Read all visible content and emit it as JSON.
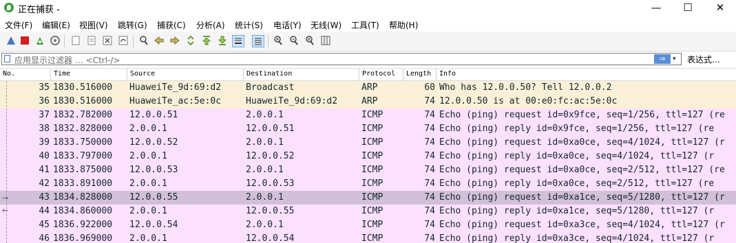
{
  "window": {
    "title": "正在捕获 -",
    "minimize": "—",
    "maximize": "☐",
    "close": "✕"
  },
  "menu": [
    "文件(F)",
    "编辑(E)",
    "视图(V)",
    "跳转(G)",
    "捕获(C)",
    "分析(A)",
    "统计(S)",
    "电话(Y)",
    "无线(W)",
    "工具(T)",
    "帮助(H)"
  ],
  "toolbar": {
    "icons": [
      "shark-fin-start-icon",
      "stop-capture-icon",
      "restart-capture-icon",
      "capture-options-icon",
      "open-file-icon",
      "save-file-icon",
      "close-file-icon",
      "reload-file-icon",
      "find-packet-icon",
      "go-back-icon",
      "go-forward-icon",
      "go-to-packet-icon",
      "go-first-icon",
      "go-last-icon",
      "autoscroll-icon",
      "colorize-icon",
      "zoom-in-icon",
      "zoom-out-icon",
      "zoom-normal-icon",
      "resize-columns-icon"
    ]
  },
  "filter": {
    "placeholder": "应用显示过滤器 … <Ctrl-/>",
    "apply_label": "⇒",
    "dropdown_label": "▾",
    "expression_label": "表达式…"
  },
  "columns": [
    "No.",
    "Time",
    "Source",
    "Destination",
    "Protocol",
    "Length",
    "Info"
  ],
  "packets": [
    {
      "no": "35",
      "time": "1830.516000",
      "source": "HuaweiTe_9d:69:d2",
      "destination": "Broadcast",
      "protocol": "ARP",
      "length": "60",
      "info": "Who has 12.0.0.50? Tell 12.0.0.2",
      "kind": "arp"
    },
    {
      "no": "36",
      "time": "1830.516000",
      "source": "HuaweiTe_ac:5e:0c",
      "destination": "HuaweiTe_9d:69:d2",
      "protocol": "ARP",
      "length": "74",
      "info": "12.0.0.50 is at 00:e0:fc:ac:5e:0c",
      "kind": "arp"
    },
    {
      "no": "37",
      "time": "1832.782000",
      "source": "12.0.0.51",
      "destination": "2.0.0.1",
      "protocol": "ICMP",
      "length": "74",
      "info": "Echo (ping) request  id=0x9fce, seq=1/256, ttl=127 (re",
      "kind": "icmp"
    },
    {
      "no": "38",
      "time": "1832.828000",
      "source": "2.0.0.1",
      "destination": "12.0.0.51",
      "protocol": "ICMP",
      "length": "74",
      "info": "Echo (ping) reply    id=0x9fce, seq=1/256, ttl=127 (re",
      "kind": "icmp"
    },
    {
      "no": "39",
      "time": "1833.750000",
      "source": "12.0.0.52",
      "destination": "2.0.0.1",
      "protocol": "ICMP",
      "length": "74",
      "info": "Echo (ping) request  id=0xa0ce, seq=4/1024, ttl=127 (r",
      "kind": "icmp"
    },
    {
      "no": "40",
      "time": "1833.797000",
      "source": "2.0.0.1",
      "destination": "12.0.0.52",
      "protocol": "ICMP",
      "length": "74",
      "info": "Echo (ping) reply    id=0xa0ce, seq=4/1024, ttl=127 (r",
      "kind": "icmp"
    },
    {
      "no": "41",
      "time": "1833.875000",
      "source": "12.0.0.53",
      "destination": "2.0.0.1",
      "protocol": "ICMP",
      "length": "74",
      "info": "Echo (ping) request  id=0xa0ce, seq=2/512, ttl=127 (re",
      "kind": "icmp"
    },
    {
      "no": "42",
      "time": "1833.891000",
      "source": "2.0.0.1",
      "destination": "12.0.0.53",
      "protocol": "ICMP",
      "length": "74",
      "info": "Echo (ping) reply    id=0xa0ce, seq=2/512, ttl=127 (re",
      "kind": "icmp"
    },
    {
      "no": "43",
      "time": "1834.828000",
      "source": "12.0.0.55",
      "destination": "2.0.0.1",
      "protocol": "ICMP",
      "length": "74",
      "info": "Echo (ping) request  id=0xa1ce, seq=5/1280, ttl=127 (r",
      "kind": "selected"
    },
    {
      "no": "44",
      "time": "1834.860000",
      "source": "2.0.0.1",
      "destination": "12.0.0.55",
      "protocol": "ICMP",
      "length": "74",
      "info": "Echo (ping) reply    id=0xa1ce, seq=5/1280, ttl=127 (r",
      "kind": "icmp"
    },
    {
      "no": "45",
      "time": "1836.922000",
      "source": "12.0.0.54",
      "destination": "2.0.0.1",
      "protocol": "ICMP",
      "length": "74",
      "info": "Echo (ping) request  id=0xa3ce, seq=4/1024, ttl=127 (r",
      "kind": "icmp"
    },
    {
      "no": "46",
      "time": "1836.969000",
      "source": "2.0.0.1",
      "destination": "12.0.0.54",
      "protocol": "ICMP",
      "length": "74",
      "info": "Echo (ping) reply    id=0xa3ce, seq=4/1024, ttl=127 (r",
      "kind": "icmp"
    }
  ],
  "colors": {
    "arp_row": "#faf0d7",
    "icmp_row": "#fce0ff",
    "selected_row": "#d2bfd8",
    "accent": "#5a8ed6"
  }
}
